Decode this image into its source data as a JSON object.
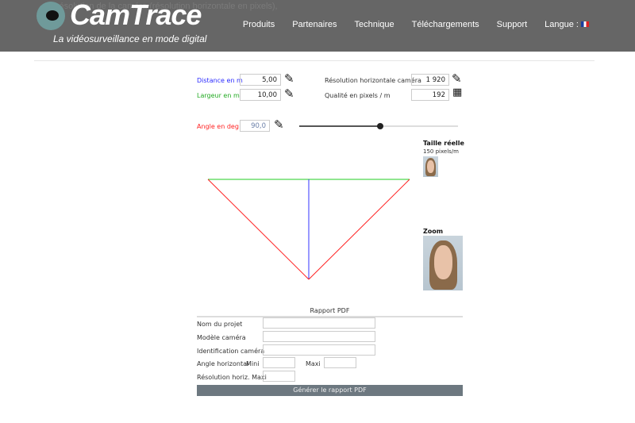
{
  "header": {
    "background_text": "– la résolution de la caméra (résolution horizontale en pixels),",
    "logo": "CamTrace",
    "tagline": "La vidéosurveillance en mode digital",
    "nav": [
      "Produits",
      "Partenaires",
      "Technique",
      "Téléchargements",
      "Support",
      "Langue :"
    ]
  },
  "form": {
    "distance_label": "Distance en m",
    "distance_value": "5,00",
    "largeur_label": "Largeur en m",
    "largeur_value": "10,00",
    "resolution_label": "Résolution horizontale caméra",
    "resolution_value": "1 920",
    "qualite_label": "Qualité en pixels / m",
    "qualite_value": "192",
    "angle_label": "Angle en deg",
    "angle_value": "90,0",
    "angle_slider_fraction": 0.51
  },
  "preview": {
    "real_title": "Taille réelle",
    "real_sub": "150 pixels/m",
    "zoom_title": "Zoom"
  },
  "colors": {
    "distance": "#2a2aff",
    "largeur": "#22aa22",
    "angle": "#ff2222"
  },
  "report": {
    "title": "Rapport PDF",
    "nom": "Nom du projet",
    "modele": "Modèle caméra",
    "ident": "Identification caméra",
    "angle": "Angle horizontal",
    "mini": "Mini",
    "maxi": "Maxi",
    "resolution": "Résolution horiz. Maxi",
    "button": "Générer le rapport PDF"
  }
}
